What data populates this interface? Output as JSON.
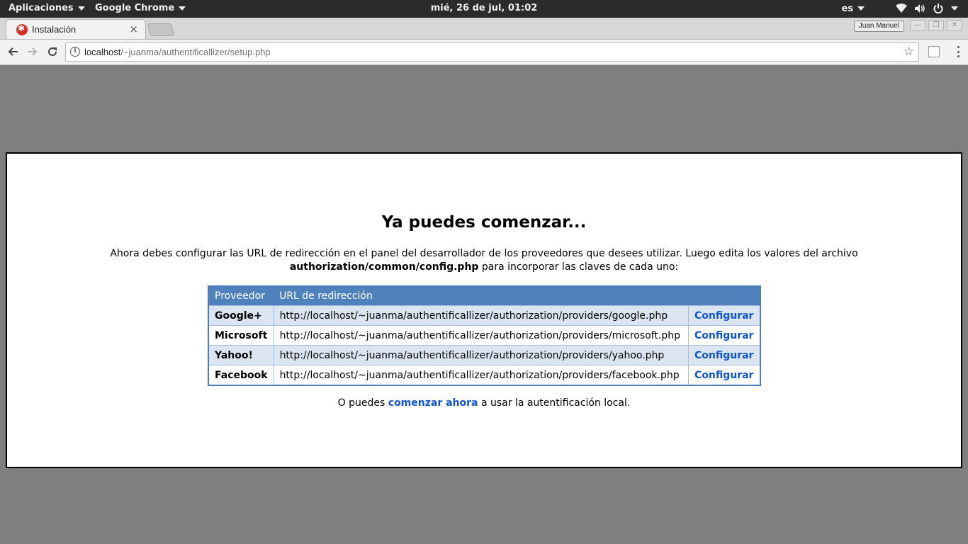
{
  "topbar": {
    "apps_label": "Aplicaciones",
    "app_label": "Google Chrome",
    "clock": "mié, 26 de jul, 01:02",
    "lang": "es"
  },
  "browser": {
    "tab_title": "Instalación",
    "tab_close": "×",
    "profile_name": "Juan Manuel",
    "url_host": "localhost",
    "url_path": "/~juanma/authentificallizer/setup.php",
    "star": "☆",
    "info": "i"
  },
  "page": {
    "heading": "Ya puedes comenzar...",
    "intro_text": "Ahora debes configurar las URL de redirección en el panel del desarrollador de los proveedores que desees utilizar. Luego edita los valores del archivo",
    "config_file": "authorization/common/config.php",
    "intro_tail": " para incorporar las claves de cada uno:",
    "table": {
      "headers": [
        "Proveedor",
        "URL de redirección",
        ""
      ],
      "rows": [
        {
          "provider": "Google+",
          "url": "http://localhost/~juanma/authentificallizer/authorization/providers/google.php",
          "action": "Configurar"
        },
        {
          "provider": "Microsoft",
          "url": "http://localhost/~juanma/authentificallizer/authorization/providers/microsoft.php",
          "action": "Configurar"
        },
        {
          "provider": "Yahoo!",
          "url": "http://localhost/~juanma/authentificallizer/authorization/providers/yahoo.php",
          "action": "Configurar"
        },
        {
          "provider": "Facebook",
          "url": "http://localhost/~juanma/authentificallizer/authorization/providers/facebook.php",
          "action": "Configurar"
        }
      ]
    },
    "outro_pre": "O puedes ",
    "outro_link": "comenzar ahora",
    "outro_post": " a usar la autentificación local."
  },
  "colors": {
    "header_blue": "#4f81bd",
    "row_blue": "#dbe5f1",
    "link_blue": "#1155cc"
  },
  "icons": [
    "caret-down-icon",
    "wifi-icon",
    "volume-icon",
    "power-icon",
    "info-icon",
    "star-icon",
    "back-icon",
    "forward-icon",
    "reload-icon",
    "menu-icon"
  ]
}
